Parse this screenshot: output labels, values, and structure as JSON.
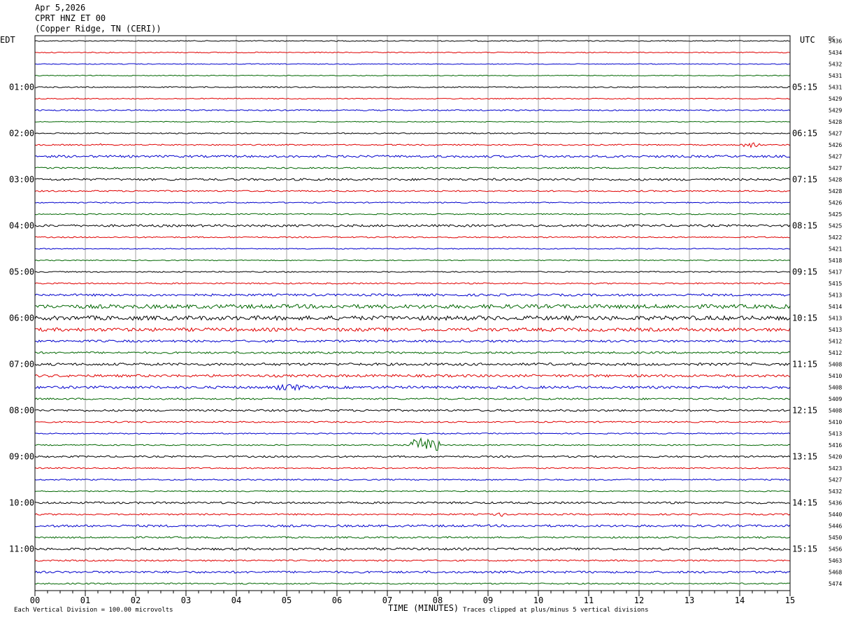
{
  "header": {
    "date": "Apr 5,2026",
    "station": "CPRT HNZ ET 00",
    "location": "(Copper Ridge, TN (CERI))"
  },
  "labels": {
    "left_zone": "EDT",
    "right_zone": "UTC",
    "dc_header": "DC",
    "xlabel": "TIME (MINUTES)",
    "scale_note": "Each Vertical Division =  100.00 microvolts",
    "clip_note": "Traces clipped at plus/minus 5 vertical divisions"
  },
  "colors": {
    "trace_cycle": [
      "#000000",
      "#e00000",
      "#0000cc",
      "#006600"
    ],
    "grid": "#a0a0a0",
    "frame": "#000000"
  },
  "chart_data": {
    "type": "line",
    "title": "CPRT HNZ ET 00",
    "xlabel": "TIME (MINUTES)",
    "xlim": [
      0,
      15
    ],
    "x_ticks": [
      "00",
      "01",
      "02",
      "03",
      "04",
      "05",
      "06",
      "07",
      "08",
      "09",
      "10",
      "11",
      "12",
      "13",
      "14",
      "15"
    ],
    "trace_interval_minutes": 15,
    "trace_count": 48,
    "edt_hour_labels": [
      "01:00",
      "02:00",
      "03:00",
      "04:00",
      "05:00",
      "06:00",
      "07:00",
      "08:00",
      "09:00",
      "10:00",
      "11:00"
    ],
    "utc_hour_labels": [
      "05:15",
      "06:15",
      "07:15",
      "08:15",
      "09:15",
      "10:15",
      "11:15",
      "12:15",
      "13:15",
      "14:15",
      "15:15"
    ],
    "first_labeled_trace_index": 4,
    "dc_offsets": [
      5436,
      5434,
      5432,
      5431,
      5431,
      5429,
      5429,
      5428,
      5427,
      5426,
      5427,
      5427,
      5428,
      5428,
      5426,
      5425,
      5425,
      5422,
      5421,
      5418,
      5417,
      5415,
      5413,
      5414,
      5413,
      5413,
      5412,
      5412,
      5408,
      5410,
      5408,
      5409,
      5408,
      5410,
      5413,
      5416,
      5420,
      5423,
      5427,
      5432,
      5436,
      5440,
      5446,
      5450,
      5456,
      5463,
      5468,
      5474
    ],
    "noise_level": [
      0.7,
      0.7,
      0.6,
      0.6,
      0.8,
      0.7,
      0.9,
      0.6,
      0.8,
      0.9,
      1.6,
      1.0,
      1.5,
      1.0,
      0.8,
      0.8,
      1.6,
      0.9,
      0.7,
      0.7,
      0.8,
      1.0,
      1.6,
      2.8,
      3.0,
      2.4,
      1.6,
      1.4,
      1.8,
      1.8,
      1.8,
      1.2,
      1.4,
      1.0,
      0.8,
      0.8,
      1.2,
      0.9,
      0.9,
      0.8,
      1.4,
      1.1,
      1.6,
      1.2,
      1.6,
      1.1,
      1.5,
      1.0
    ],
    "events": [
      {
        "trace": 9,
        "minute": 1.3,
        "amplitude": 5,
        "duration_min": 0.05
      },
      {
        "trace": 9,
        "minute": 14.2,
        "amplitude": 3,
        "duration_min": 0.4
      },
      {
        "trace": 30,
        "minute": 5.1,
        "amplitude": 3,
        "duration_min": 0.6
      },
      {
        "trace": 35,
        "minute": 7.75,
        "amplitude": 9,
        "duration_min": 0.6
      },
      {
        "trace": 41,
        "minute": 9.2,
        "amplitude": 3,
        "duration_min": 0.2
      }
    ]
  }
}
